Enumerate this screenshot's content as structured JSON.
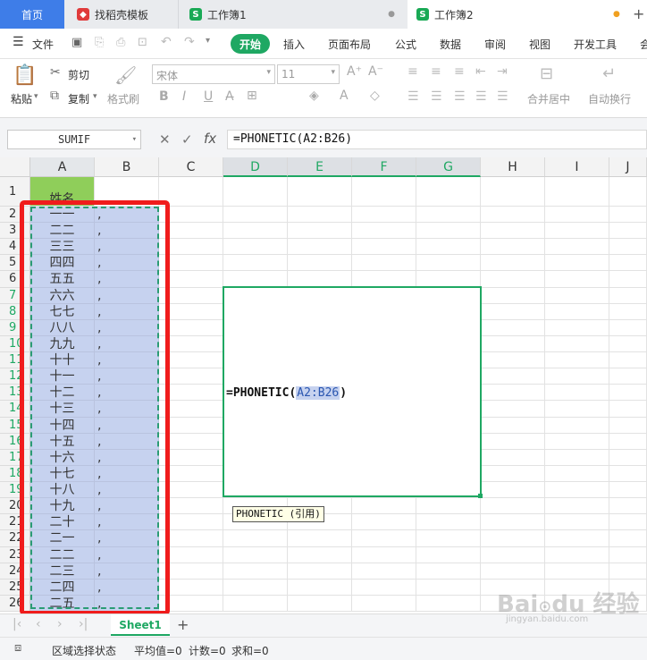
{
  "tabs": {
    "home": "首页",
    "template": "找稻壳模板",
    "book1": "工作簿1",
    "book2": "工作簿2"
  },
  "menu": {
    "file": "文件",
    "items": [
      "开始",
      "插入",
      "页面布局",
      "公式",
      "数据",
      "审阅",
      "视图",
      "开发工具",
      "会"
    ]
  },
  "toolbar": {
    "paste": "粘贴",
    "cut": "剪切",
    "copy": "复制",
    "format_painter": "格式刷",
    "font_name": "宋体",
    "font_size": "11",
    "merge": "合并居中",
    "wrap": "自动换行"
  },
  "formula_bar": {
    "name_box": "SUMIF",
    "fx": "fx",
    "formula": "=PHONETIC(A2:B26)"
  },
  "columns": [
    "A",
    "B",
    "C",
    "D",
    "E",
    "F",
    "G",
    "H",
    "I",
    "J"
  ],
  "header_cell": "姓名",
  "names": [
    "一一",
    "二二",
    "三三",
    "四四",
    "五五",
    "六六",
    "七七",
    "八八",
    "九九",
    "十十",
    "十一",
    "十二",
    "十三",
    "十四",
    "十五",
    "十六",
    "十七",
    "十八",
    "十九",
    "二十",
    "二一",
    "二二",
    "二三",
    "二四",
    "二五",
    "二六"
  ],
  "comma": ",",
  "rows": [
    "1",
    "2",
    "3",
    "4",
    "5",
    "6",
    "7",
    "8",
    "9",
    "10",
    "11",
    "12",
    "13",
    "14",
    "15",
    "16",
    "17",
    "18",
    "19",
    "20",
    "21",
    "22",
    "23",
    "24",
    "25",
    "26"
  ],
  "edit": {
    "prefix": "=PHONETIC(",
    "ref": "A2:B26",
    "suffix": ")",
    "tooltip": "PHONETIC (引用)"
  },
  "sheet": {
    "name": "Sheet1",
    "add": "+"
  },
  "status": {
    "mode": "区域选择状态",
    "avg": "平均值=0",
    "count": "计数=0",
    "sum": "求和=0"
  },
  "colors": {
    "accent": "#1fa863",
    "selection": "#c6d2ef",
    "annotation": "#f01c1c",
    "tab_blue": "#3e7de8"
  }
}
